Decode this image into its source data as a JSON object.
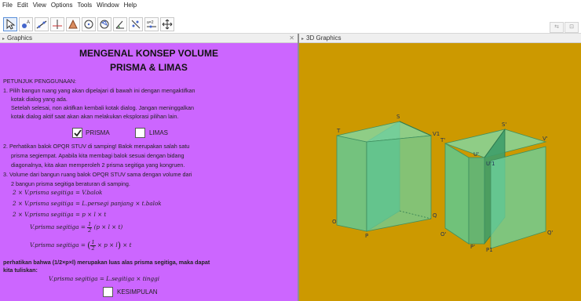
{
  "menu": [
    "File",
    "Edit",
    "View",
    "Options",
    "Tools",
    "Window",
    "Help"
  ],
  "toolbar": {
    "tools": [
      "move-tool-icon",
      "point-tool-icon",
      "line-tool-icon",
      "perpendicular-tool-icon",
      "polygon-tool-icon",
      "circle-tool-icon",
      "sphere-tool-icon",
      "angle-tool-icon",
      "reflect-tool-icon",
      "slider-tool-icon",
      "move-view-tool-icon"
    ],
    "selected": 0
  },
  "panels": {
    "graphics_title": "Graphics",
    "graphics3d_title": "3D Graphics"
  },
  "colors": {
    "graphics_bg": "#cc66ff",
    "graphics3d_bg": "#cc9900",
    "prism_face": "#5fc98f",
    "prism_edge": "#3a8a5a"
  },
  "content": {
    "title": "MENGENAL KONSEP VOLUME",
    "subtitle": "PRISMA & LIMAS",
    "instructions_heading": "PETUNJUK PENGGUNAAN:",
    "step1_a": "1. Pilih bangun ruang yang akan dipelajari di bawah ini dengan mengaktifkan",
    "step1_b": "kotak dialog yang ada.",
    "step1_c": "Setelah selesai, non aktifkan kembali kotak dialog. Jangan meninggalkan",
    "step1_d": "kotak dialog aktif saat akan akan melakukan eksplorasi pilihan lain.",
    "prisma_label": "PRISMA",
    "limas_label": "LIMAS",
    "prisma_checked": true,
    "limas_checked": false,
    "step2_a": "2. Perhatikan balok OPQR STUV di samping! Balok merupakan salah satu",
    "step2_b": "prisma segiempat. Apabila kita membagi balok sesuai dengan bidang",
    "step2_c": "diagonalnya, kita akan memperoleh 2 prisma segitiga yang kongruen.",
    "step3_a": "3. Volume dari bangun ruang balok OPQR STUV sama dengan volume dari",
    "step3_b": "2 bangun prisma segitiga beraturan di samping.",
    "eq1": "2 × V.prisma segitiga = V.balok",
    "eq2": "2 × V.prisma segitiga = L.persegi panjang × t.balok",
    "eq3": "2 × V.prisma segitiga = p × l × t",
    "eq4_left": "V.prisma segitiga =",
    "eq4_num": "1",
    "eq4_den": "2",
    "eq4_right": "(p × l × t)",
    "eq5_left": "V.prisma segitiga =",
    "eq5_num": "1",
    "eq5_den": "2",
    "eq5_mid": "× p × l",
    "eq5_right": "× t",
    "note_a": "perhatikan bahwa (1/2×p×l) merupakan luas alas prisma segitiga, maka dapat",
    "note_b": "kita tuliskan:",
    "eq6": "V.prisma segitiga = L.segitiga × tinggi",
    "kesimpulan_label": "KESIMPULAN",
    "kesimpulan_checked": false
  },
  "scene3d": {
    "left_prism_labels": [
      "T",
      "S",
      "V1",
      "O",
      "P",
      "Q"
    ],
    "right_prism_labels": [
      "T'",
      "S'",
      "U'",
      "V'",
      "U'1",
      "O'",
      "P'",
      "P1",
      "Q'"
    ]
  }
}
